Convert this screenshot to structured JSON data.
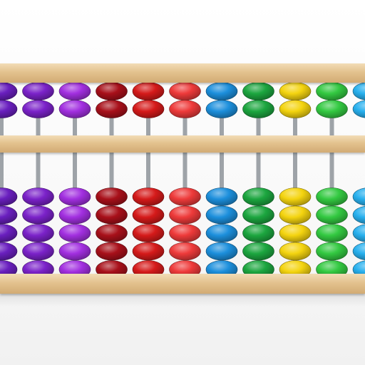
{
  "abacus": {
    "frame_wood_color": "#e3c28e",
    "rod_color": "#9ea3a8",
    "upper_beads_per_rod": 2,
    "lower_beads_per_rod": 5,
    "rods": [
      {
        "color_name": "violet",
        "color": "#6a1fbf"
      },
      {
        "color_name": "purple",
        "color": "#7b22c9"
      },
      {
        "color_name": "magenta",
        "color": "#a22fe0"
      },
      {
        "color_name": "dark-red",
        "color": "#a8101a"
      },
      {
        "color_name": "red",
        "color": "#d51a1a"
      },
      {
        "color_name": "light-red",
        "color": "#ee3a3a"
      },
      {
        "color_name": "blue",
        "color": "#1c8fdc"
      },
      {
        "color_name": "green",
        "color": "#1ca63f"
      },
      {
        "color_name": "yellow",
        "color": "#f4d40f"
      },
      {
        "color_name": "lime-green",
        "color": "#33c941"
      },
      {
        "color_name": "cyan",
        "color": "#28b0ee"
      }
    ]
  }
}
